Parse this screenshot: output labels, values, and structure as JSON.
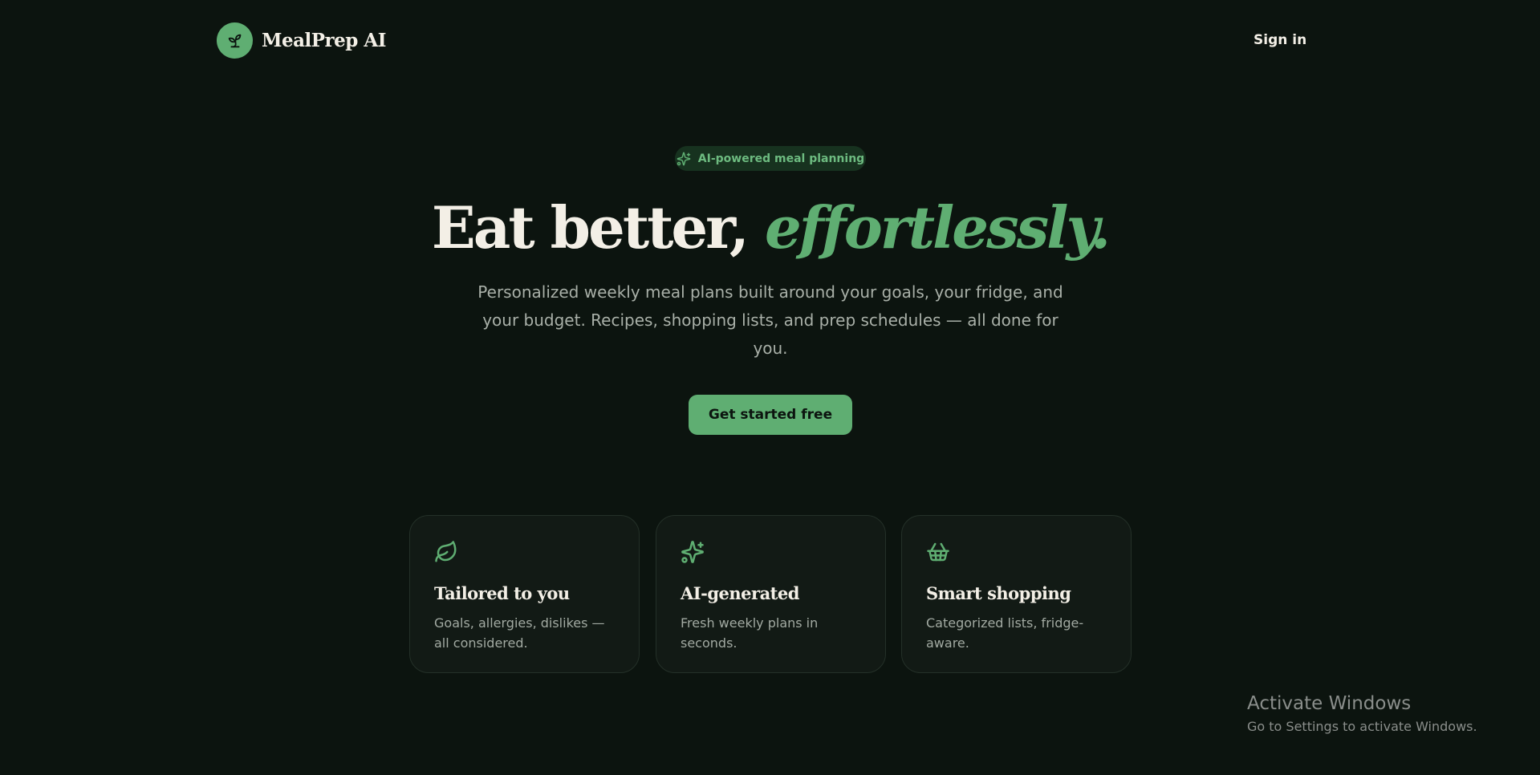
{
  "header": {
    "brand_name": "MealPrep AI",
    "logo_icon": "sprout-icon",
    "sign_in_label": "Sign in"
  },
  "hero": {
    "badge_icon": "sparkles-icon",
    "badge_label": "AI-powered meal planning",
    "headline_start": "Eat better, ",
    "headline_accent": "effortlessly.",
    "subtitle": "Personalized weekly meal plans built around your goals, your fridge, and your budget. Recipes, shopping lists, and prep schedules — all done for you.",
    "cta_label": "Get started free"
  },
  "features": [
    {
      "icon": "leaf-icon",
      "title": "Tailored to you",
      "description": "Goals, allergies, dislikes — all considered."
    },
    {
      "icon": "sparkles-icon",
      "title": "AI-generated",
      "description": "Fresh weekly plans in seconds."
    },
    {
      "icon": "basket-icon",
      "title": "Smart shopping",
      "description": "Categorized lists, fridge-aware."
    }
  ],
  "watermark": {
    "title": "Activate Windows",
    "subtitle": "Go to Settings to activate Windows."
  },
  "colors": {
    "background": "#0c140f",
    "accent": "#5fae72",
    "text": "#f3efe6",
    "muted_text": "#a9b0a8",
    "card_background": "#121a15"
  }
}
